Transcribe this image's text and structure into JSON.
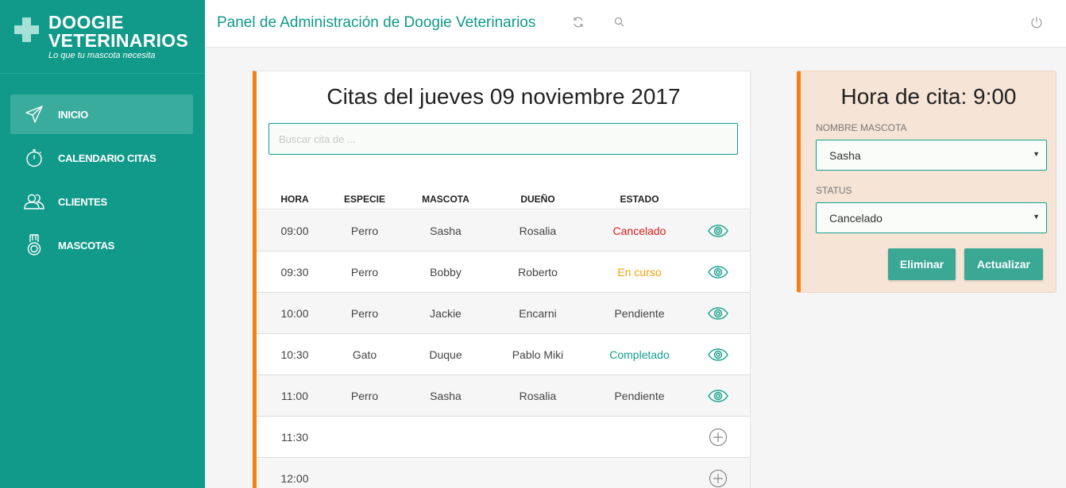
{
  "brand": {
    "line1": "DOOGIE",
    "line2": "VETERINARIOS",
    "tagline": "Lo que tu mascota necesita"
  },
  "nav": [
    {
      "label": "INICIO",
      "icon": "send-icon",
      "active": true
    },
    {
      "label": "CALENDARIO CITAS",
      "icon": "stopwatch-icon",
      "active": false
    },
    {
      "label": "CLIENTES",
      "icon": "users-icon",
      "active": false
    },
    {
      "label": "MASCOTAS",
      "icon": "medal-icon",
      "active": false
    }
  ],
  "header": {
    "title": "Panel de Administración de Doogie Veterinarios",
    "icons": [
      "refresh-icon",
      "search-icon",
      "power-icon"
    ]
  },
  "appointments": {
    "title": "Citas del jueves 09 noviembre 2017",
    "search_placeholder": "Buscar cita de ...",
    "columns": [
      "HORA",
      "ESPECIE",
      "MASCOTA",
      "DUEÑO",
      "ESTADO"
    ],
    "rows": [
      {
        "hora": "09:00",
        "especie": "Perro",
        "mascota": "Sasha",
        "dueno": "Rosalia",
        "estado": "Cancelado",
        "estado_color": "#e21b1b",
        "action": "eye-icon"
      },
      {
        "hora": "09:30",
        "especie": "Perro",
        "mascota": "Bobby",
        "dueno": "Roberto",
        "estado": "En curso",
        "estado_color": "#f2a20c",
        "action": "eye-icon"
      },
      {
        "hora": "10:00",
        "especie": "Perro",
        "mascota": "Jackie",
        "dueno": "Encarni",
        "estado": "Pendiente",
        "estado_color": "#444444",
        "action": "eye-icon"
      },
      {
        "hora": "10:30",
        "especie": "Gato",
        "mascota": "Duque",
        "dueno": "Pablo Miki",
        "estado": "Completado",
        "estado_color": "#13a08c",
        "action": "eye-icon"
      },
      {
        "hora": "11:00",
        "especie": "Perro",
        "mascota": "Sasha",
        "dueno": "Rosalia",
        "estado": "Pendiente",
        "estado_color": "#444444",
        "action": "eye-icon"
      },
      {
        "hora": "11:30",
        "especie": "",
        "mascota": "",
        "dueno": "",
        "estado": "",
        "estado_color": "#444444",
        "action": "plus-circle-icon"
      },
      {
        "hora": "12:00",
        "especie": "",
        "mascota": "",
        "dueno": "",
        "estado": "",
        "estado_color": "#444444",
        "action": "plus-circle-icon"
      }
    ]
  },
  "detail": {
    "title": "Hora de cita: 9:00",
    "pet_label": "NOMBRE MASCOTA",
    "pet_value": "Sasha",
    "status_label": "STATUS",
    "status_value": "Cancelado",
    "delete_label": "Eliminar",
    "update_label": "Actualizar"
  },
  "colors": {
    "sidebar": "#119a89",
    "accent": "#f57f17",
    "button": "#3aa895"
  }
}
